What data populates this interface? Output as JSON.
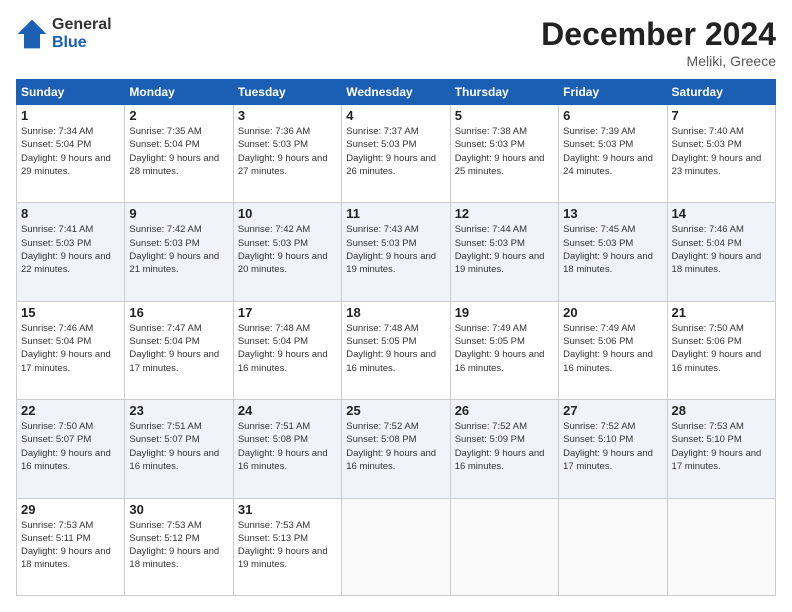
{
  "header": {
    "logo_line1": "General",
    "logo_line2": "Blue",
    "month_title": "December 2024",
    "location": "Meliki, Greece"
  },
  "weekdays": [
    "Sunday",
    "Monday",
    "Tuesday",
    "Wednesday",
    "Thursday",
    "Friday",
    "Saturday"
  ],
  "weeks": [
    [
      {
        "day": "1",
        "sunrise": "Sunrise: 7:34 AM",
        "sunset": "Sunset: 5:04 PM",
        "daylight": "Daylight: 9 hours and 29 minutes."
      },
      {
        "day": "2",
        "sunrise": "Sunrise: 7:35 AM",
        "sunset": "Sunset: 5:04 PM",
        "daylight": "Daylight: 9 hours and 28 minutes."
      },
      {
        "day": "3",
        "sunrise": "Sunrise: 7:36 AM",
        "sunset": "Sunset: 5:03 PM",
        "daylight": "Daylight: 9 hours and 27 minutes."
      },
      {
        "day": "4",
        "sunrise": "Sunrise: 7:37 AM",
        "sunset": "Sunset: 5:03 PM",
        "daylight": "Daylight: 9 hours and 26 minutes."
      },
      {
        "day": "5",
        "sunrise": "Sunrise: 7:38 AM",
        "sunset": "Sunset: 5:03 PM",
        "daylight": "Daylight: 9 hours and 25 minutes."
      },
      {
        "day": "6",
        "sunrise": "Sunrise: 7:39 AM",
        "sunset": "Sunset: 5:03 PM",
        "daylight": "Daylight: 9 hours and 24 minutes."
      },
      {
        "day": "7",
        "sunrise": "Sunrise: 7:40 AM",
        "sunset": "Sunset: 5:03 PM",
        "daylight": "Daylight: 9 hours and 23 minutes."
      }
    ],
    [
      {
        "day": "8",
        "sunrise": "Sunrise: 7:41 AM",
        "sunset": "Sunset: 5:03 PM",
        "daylight": "Daylight: 9 hours and 22 minutes."
      },
      {
        "day": "9",
        "sunrise": "Sunrise: 7:42 AM",
        "sunset": "Sunset: 5:03 PM",
        "daylight": "Daylight: 9 hours and 21 minutes."
      },
      {
        "day": "10",
        "sunrise": "Sunrise: 7:42 AM",
        "sunset": "Sunset: 5:03 PM",
        "daylight": "Daylight: 9 hours and 20 minutes."
      },
      {
        "day": "11",
        "sunrise": "Sunrise: 7:43 AM",
        "sunset": "Sunset: 5:03 PM",
        "daylight": "Daylight: 9 hours and 19 minutes."
      },
      {
        "day": "12",
        "sunrise": "Sunrise: 7:44 AM",
        "sunset": "Sunset: 5:03 PM",
        "daylight": "Daylight: 9 hours and 19 minutes."
      },
      {
        "day": "13",
        "sunrise": "Sunrise: 7:45 AM",
        "sunset": "Sunset: 5:03 PM",
        "daylight": "Daylight: 9 hours and 18 minutes."
      },
      {
        "day": "14",
        "sunrise": "Sunrise: 7:46 AM",
        "sunset": "Sunset: 5:04 PM",
        "daylight": "Daylight: 9 hours and 18 minutes."
      }
    ],
    [
      {
        "day": "15",
        "sunrise": "Sunrise: 7:46 AM",
        "sunset": "Sunset: 5:04 PM",
        "daylight": "Daylight: 9 hours and 17 minutes."
      },
      {
        "day": "16",
        "sunrise": "Sunrise: 7:47 AM",
        "sunset": "Sunset: 5:04 PM",
        "daylight": "Daylight: 9 hours and 17 minutes."
      },
      {
        "day": "17",
        "sunrise": "Sunrise: 7:48 AM",
        "sunset": "Sunset: 5:04 PM",
        "daylight": "Daylight: 9 hours and 16 minutes."
      },
      {
        "day": "18",
        "sunrise": "Sunrise: 7:48 AM",
        "sunset": "Sunset: 5:05 PM",
        "daylight": "Daylight: 9 hours and 16 minutes."
      },
      {
        "day": "19",
        "sunrise": "Sunrise: 7:49 AM",
        "sunset": "Sunset: 5:05 PM",
        "daylight": "Daylight: 9 hours and 16 minutes."
      },
      {
        "day": "20",
        "sunrise": "Sunrise: 7:49 AM",
        "sunset": "Sunset: 5:06 PM",
        "daylight": "Daylight: 9 hours and 16 minutes."
      },
      {
        "day": "21",
        "sunrise": "Sunrise: 7:50 AM",
        "sunset": "Sunset: 5:06 PM",
        "daylight": "Daylight: 9 hours and 16 minutes."
      }
    ],
    [
      {
        "day": "22",
        "sunrise": "Sunrise: 7:50 AM",
        "sunset": "Sunset: 5:07 PM",
        "daylight": "Daylight: 9 hours and 16 minutes."
      },
      {
        "day": "23",
        "sunrise": "Sunrise: 7:51 AM",
        "sunset": "Sunset: 5:07 PM",
        "daylight": "Daylight: 9 hours and 16 minutes."
      },
      {
        "day": "24",
        "sunrise": "Sunrise: 7:51 AM",
        "sunset": "Sunset: 5:08 PM",
        "daylight": "Daylight: 9 hours and 16 minutes."
      },
      {
        "day": "25",
        "sunrise": "Sunrise: 7:52 AM",
        "sunset": "Sunset: 5:08 PM",
        "daylight": "Daylight: 9 hours and 16 minutes."
      },
      {
        "day": "26",
        "sunrise": "Sunrise: 7:52 AM",
        "sunset": "Sunset: 5:09 PM",
        "daylight": "Daylight: 9 hours and 16 minutes."
      },
      {
        "day": "27",
        "sunrise": "Sunrise: 7:52 AM",
        "sunset": "Sunset: 5:10 PM",
        "daylight": "Daylight: 9 hours and 17 minutes."
      },
      {
        "day": "28",
        "sunrise": "Sunrise: 7:53 AM",
        "sunset": "Sunset: 5:10 PM",
        "daylight": "Daylight: 9 hours and 17 minutes."
      }
    ],
    [
      {
        "day": "29",
        "sunrise": "Sunrise: 7:53 AM",
        "sunset": "Sunset: 5:11 PM",
        "daylight": "Daylight: 9 hours and 18 minutes."
      },
      {
        "day": "30",
        "sunrise": "Sunrise: 7:53 AM",
        "sunset": "Sunset: 5:12 PM",
        "daylight": "Daylight: 9 hours and 18 minutes."
      },
      {
        "day": "31",
        "sunrise": "Sunrise: 7:53 AM",
        "sunset": "Sunset: 5:13 PM",
        "daylight": "Daylight: 9 hours and 19 minutes."
      },
      null,
      null,
      null,
      null
    ]
  ]
}
